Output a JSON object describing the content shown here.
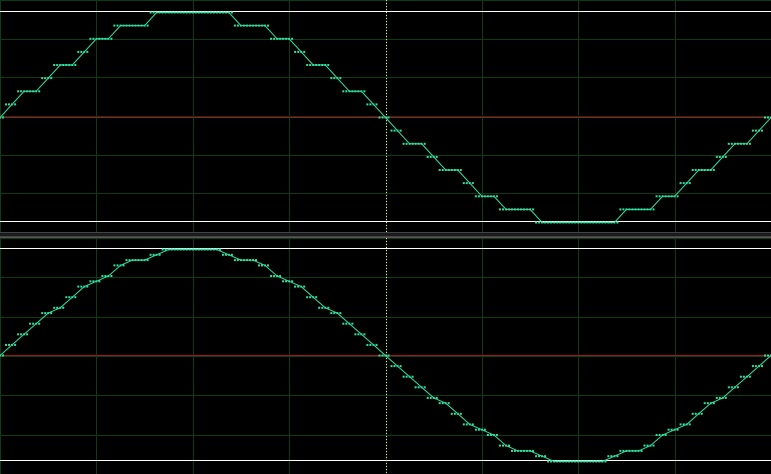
{
  "window": {
    "background": "#000000",
    "grid_color": "#0e3a16",
    "trace_color": "#2fe0a0",
    "reference_line_color": "#a01818",
    "boundary_line_color": "#ffffff",
    "cursor_color": "#e8e0a0"
  },
  "chart_data": [
    {
      "type": "line",
      "name_in_ui": "",
      "style": "quantized-steps",
      "x_range": [
        0,
        1
      ],
      "y_range": [
        -1,
        1
      ],
      "grid": true,
      "cursor_x": 0.5,
      "reference_level": 0,
      "quantization_steps": 16,
      "samples": 64
    },
    {
      "type": "line",
      "name_in_ui": "",
      "style": "fine-steps",
      "x_range": [
        0,
        1
      ],
      "y_range": [
        -1,
        1
      ],
      "grid": true,
      "cursor_x": 0.5,
      "reference_level": 0,
      "quantization_steps": 40,
      "samples": 64
    }
  ]
}
